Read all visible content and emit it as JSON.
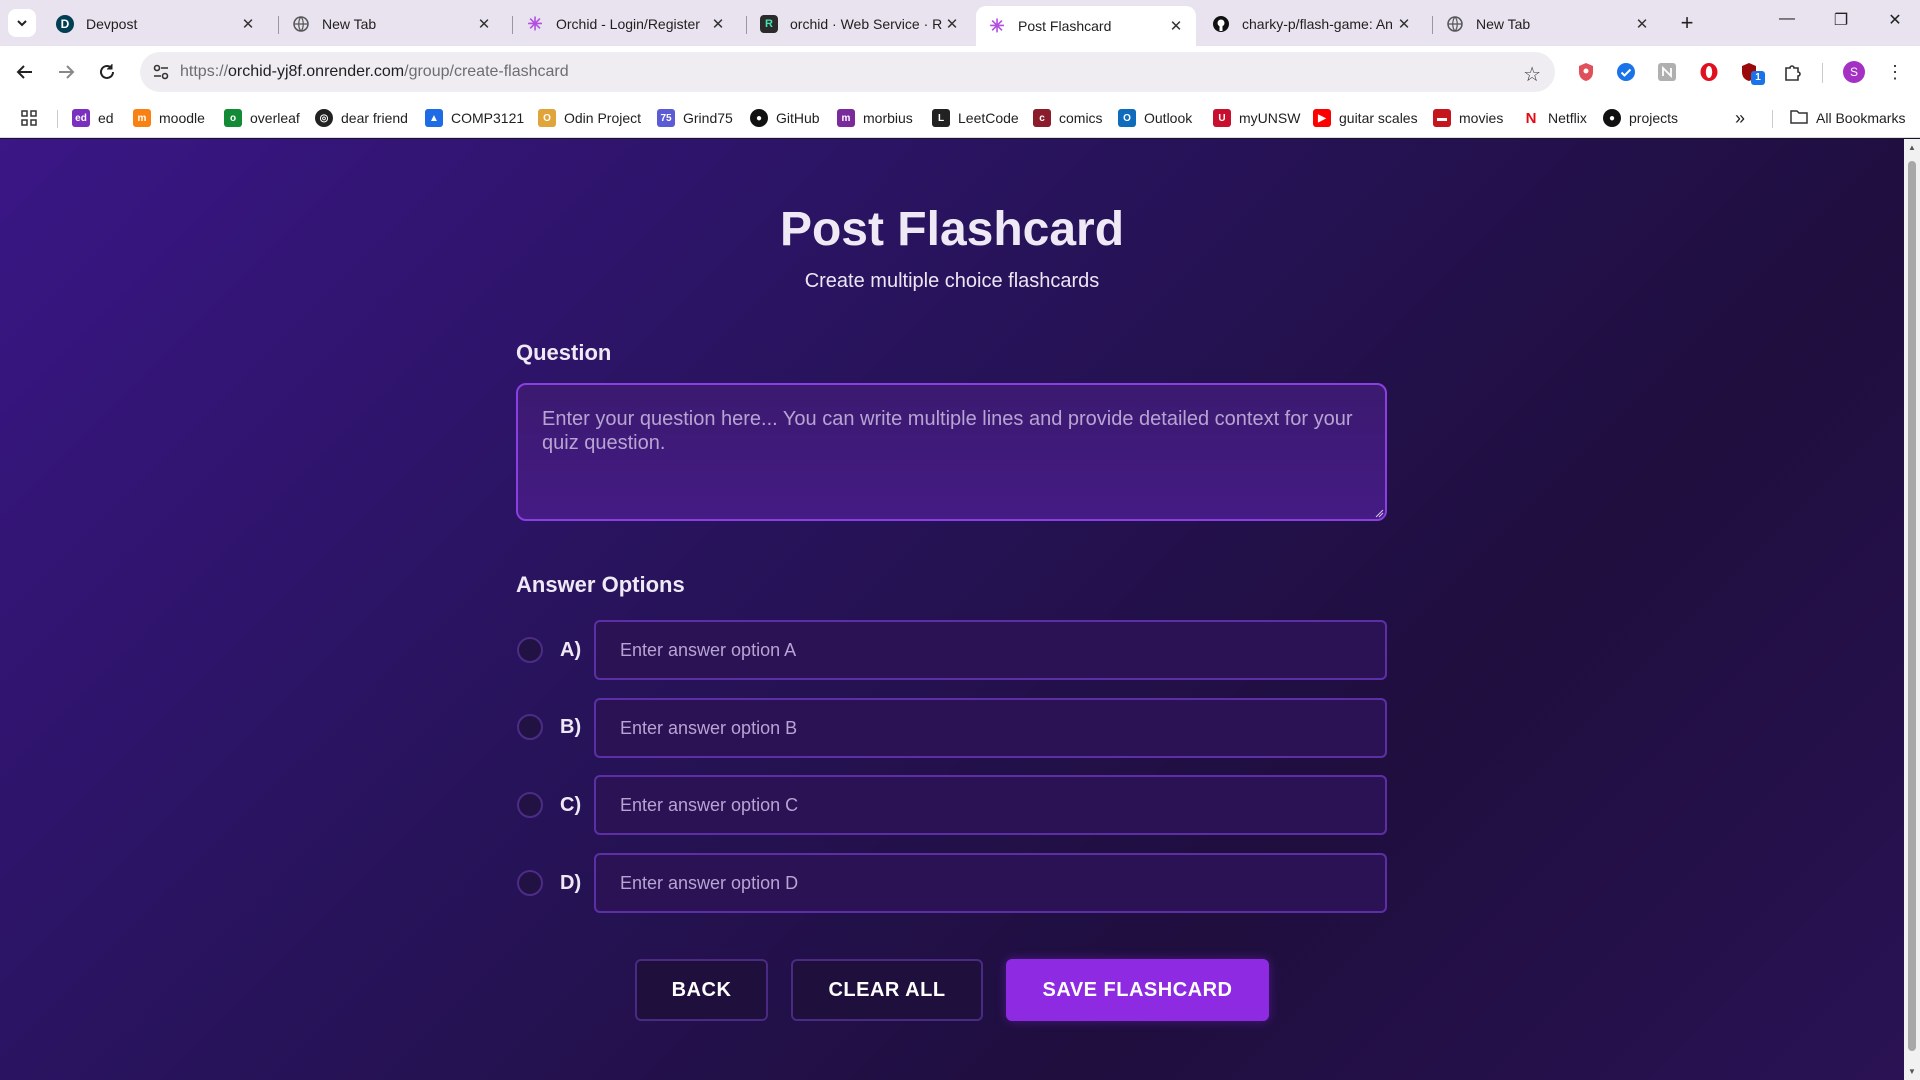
{
  "browser": {
    "tabs": [
      {
        "title": "Devpost",
        "icon": "devpost-icon",
        "active": false
      },
      {
        "title": "New Tab",
        "icon": "globe-icon",
        "active": false
      },
      {
        "title": "Orchid - Login/Register",
        "icon": "orchid-icon",
        "active": false
      },
      {
        "title": "orchid · Web Service · R",
        "icon": "render-icon",
        "active": false
      },
      {
        "title": "Post Flashcard",
        "icon": "orchid-icon",
        "active": true
      },
      {
        "title": "charky-p/flash-game: An",
        "icon": "github-icon",
        "active": false
      },
      {
        "title": "New Tab",
        "icon": "globe-icon",
        "active": false
      }
    ],
    "url_prefix": "https://",
    "url_host": "orchid-yj8f.onrender.com",
    "url_path": "/group/create-flashcard",
    "profile_initial": "S",
    "extension_badge": "1",
    "bookmarks": [
      {
        "label": "ed",
        "icon": "ed-icon",
        "color": "#7b2fbe"
      },
      {
        "label": "moodle",
        "icon": "moodle-icon",
        "color": "#f98012"
      },
      {
        "label": "overleaf",
        "icon": "overleaf-icon",
        "color": "#138a36"
      },
      {
        "label": "dear friend",
        "icon": "dear-friend-icon",
        "color": "#222222"
      },
      {
        "label": "COMP3121",
        "icon": "comp3121-icon",
        "color": "#1e6be6"
      },
      {
        "label": "Odin Project",
        "icon": "odin-icon",
        "color": "#e0a43a"
      },
      {
        "label": "Grind75",
        "icon": "grind75-icon",
        "color": "#5b5bd6"
      },
      {
        "label": "GitHub",
        "icon": "github-icon",
        "color": "#111111"
      },
      {
        "label": "morbius",
        "icon": "morbius-icon",
        "color": "#7a2a9a"
      },
      {
        "label": "LeetCode",
        "icon": "leetcode-icon",
        "color": "#222222"
      },
      {
        "label": "comics",
        "icon": "comics-icon",
        "color": "#8b1c2c"
      },
      {
        "label": "Outlook",
        "icon": "outlook-icon",
        "color": "#0f6cbd"
      },
      {
        "label": "myUNSW",
        "icon": "myunsw-icon",
        "color": "#c8102e"
      },
      {
        "label": "guitar scales",
        "icon": "youtube-icon",
        "color": "#ff0000"
      },
      {
        "label": "movies",
        "icon": "movies-icon",
        "color": "#c4161c"
      },
      {
        "label": "Netflix",
        "icon": "netflix-icon",
        "color": "#e50914"
      },
      {
        "label": "projects",
        "icon": "github-icon",
        "color": "#111111"
      }
    ],
    "all_bookmarks_label": "All Bookmarks"
  },
  "page": {
    "title": "Post Flashcard",
    "subtitle": "Create multiple choice flashcards",
    "question_label": "Question",
    "question_placeholder": "Enter your question here... You can write multiple lines and provide detailed context for your quiz question.",
    "answers_label": "Answer Options",
    "options": [
      {
        "letter": "A)",
        "placeholder": "Enter answer option A"
      },
      {
        "letter": "B)",
        "placeholder": "Enter answer option B"
      },
      {
        "letter": "C)",
        "placeholder": "Enter answer option C"
      },
      {
        "letter": "D)",
        "placeholder": "Enter answer option D"
      }
    ],
    "buttons": {
      "back": "BACK",
      "clear": "CLEAR ALL",
      "save": "SAVE FLASHCARD"
    },
    "colors": {
      "accent": "#8e2be2",
      "background": "#27135a",
      "question_border": "#8c3fe0"
    }
  }
}
